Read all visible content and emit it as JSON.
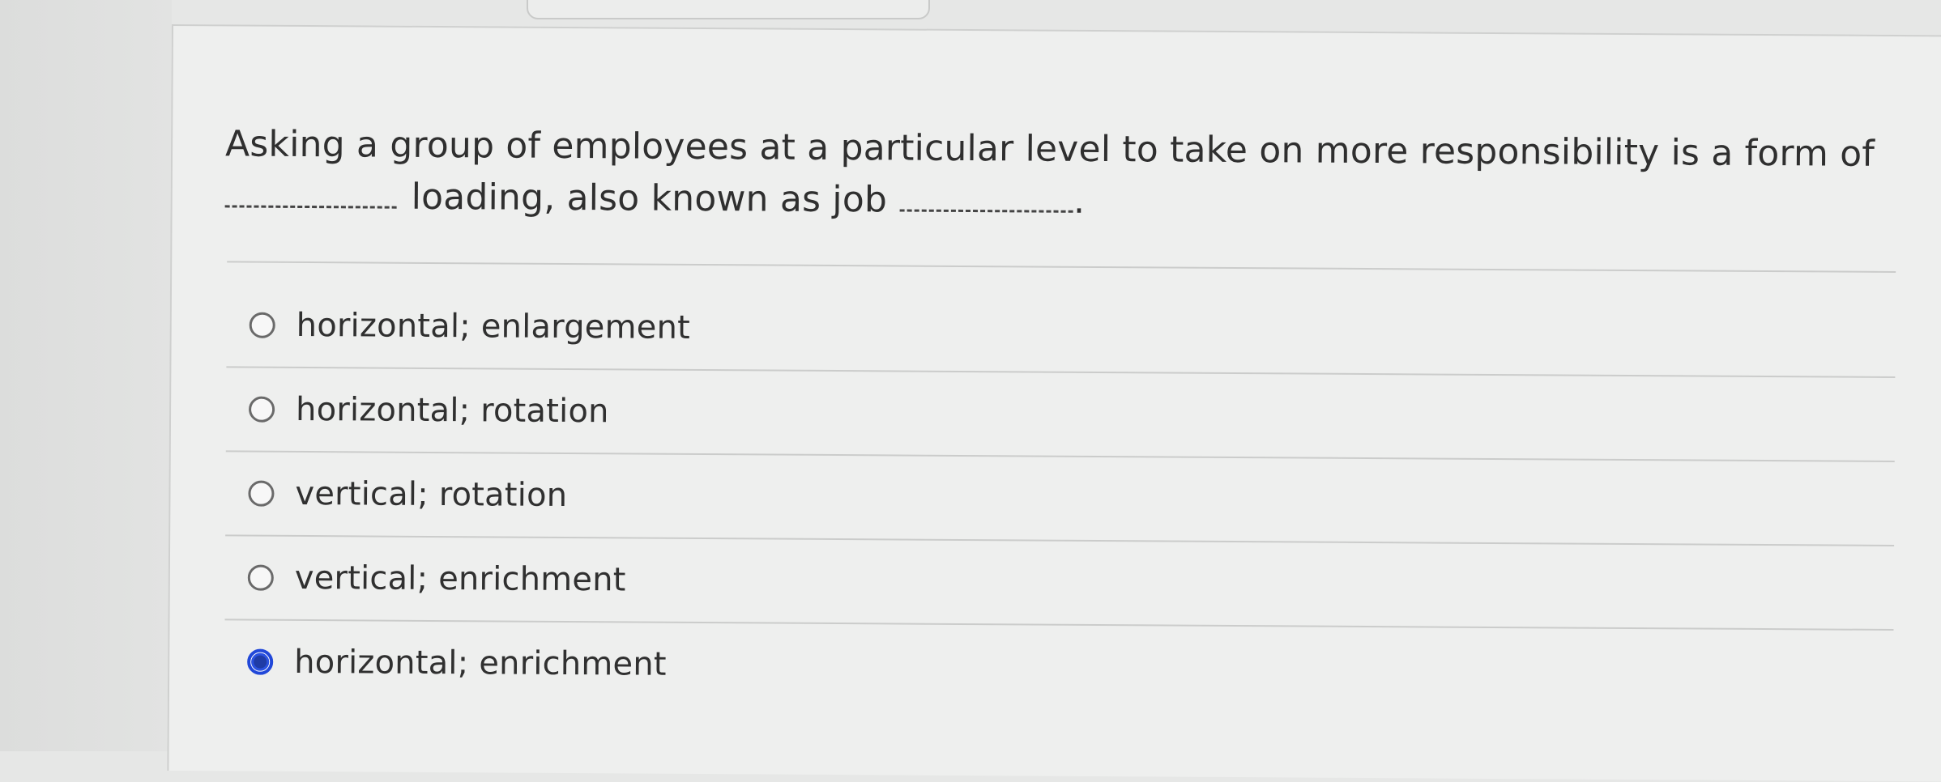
{
  "question": {
    "line1": "Asking a group of employees at a particular level to take on more responsibility is a form of",
    "line2_middle": "loading, also known as job",
    "line2_end": "."
  },
  "options": [
    {
      "label": "horizontal; enlargement",
      "selected": false
    },
    {
      "label": "horizontal; rotation",
      "selected": false
    },
    {
      "label": "vertical; rotation",
      "selected": false
    },
    {
      "label": "vertical; enrichment",
      "selected": false
    },
    {
      "label": "horizontal; enrichment",
      "selected": true
    }
  ],
  "colors": {
    "selected_radio": "#2148d9",
    "text": "#2f2f2f",
    "panel_background": "#eeefee"
  }
}
